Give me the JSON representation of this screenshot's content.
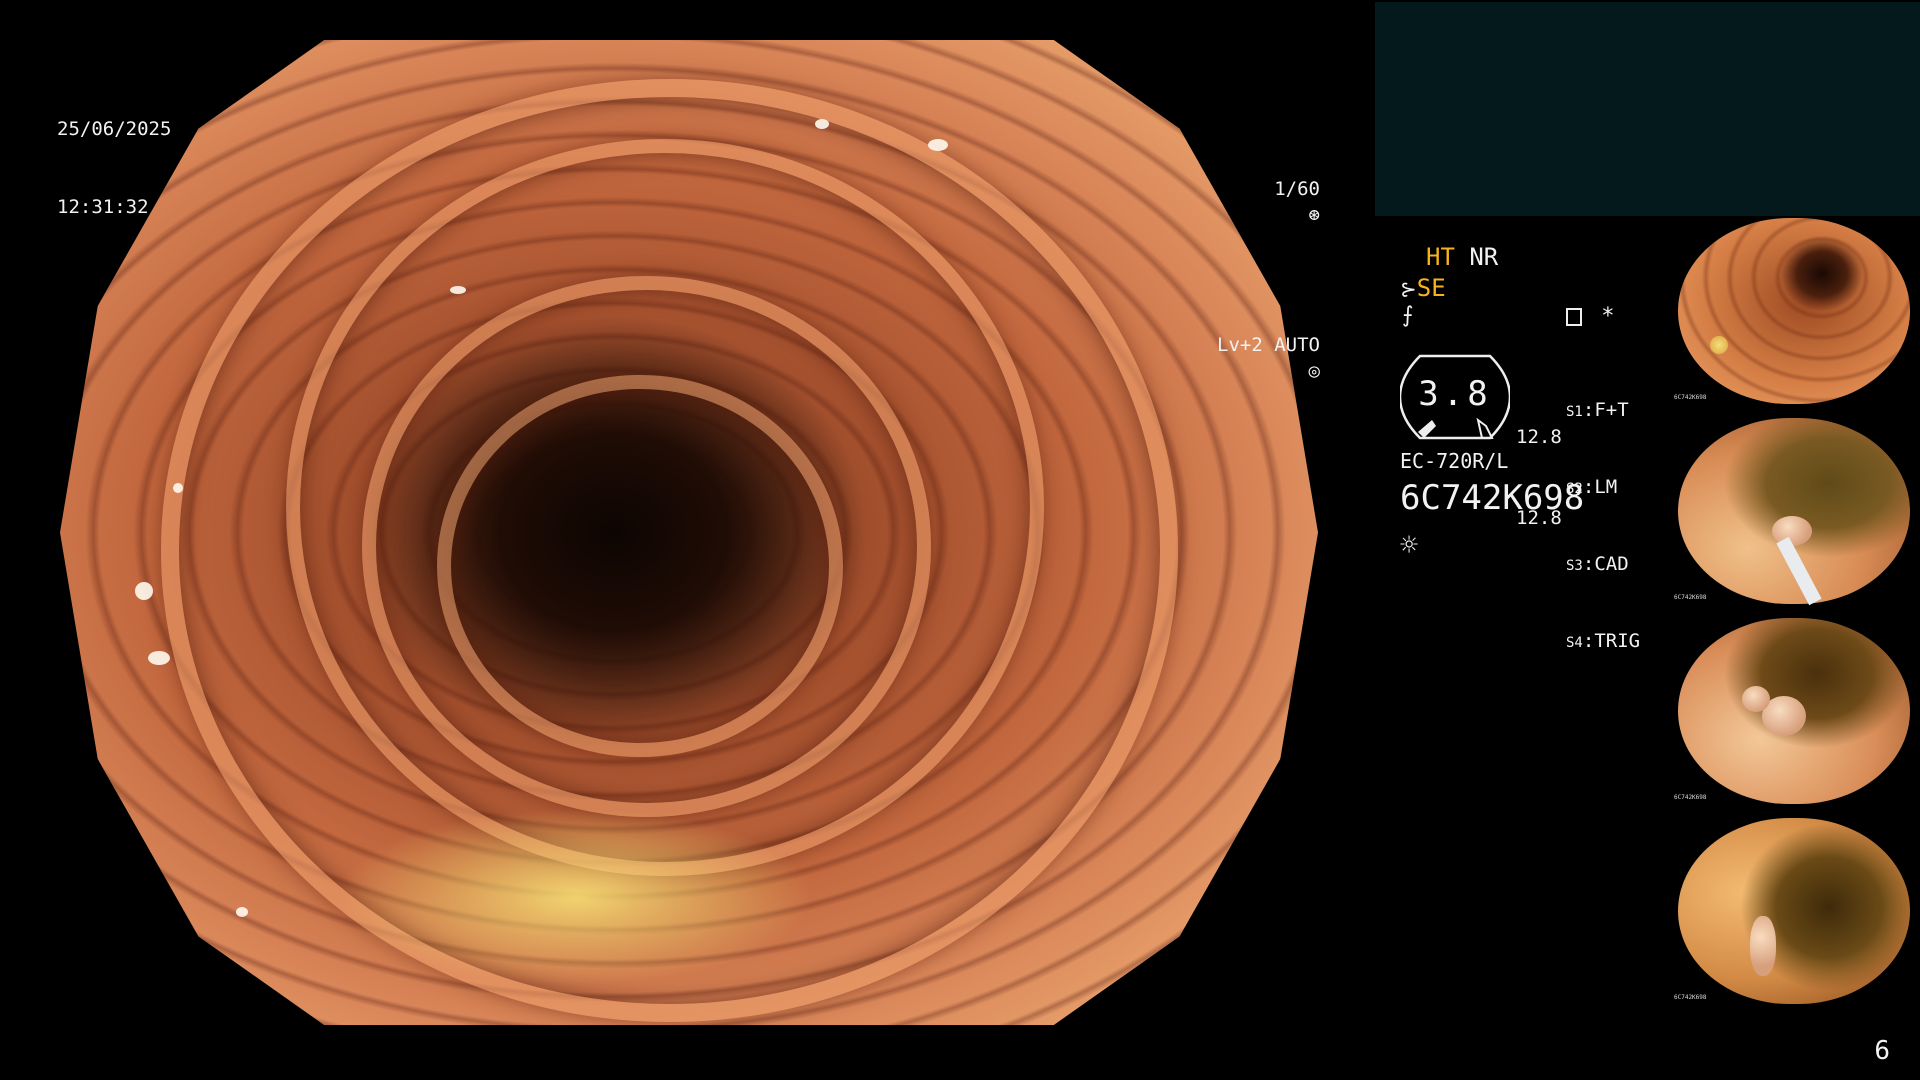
{
  "osd": {
    "date": "25/06/2025",
    "time": "12:31:32",
    "shutter": "1/60",
    "level": "Lv+2 AUTO"
  },
  "panel": {
    "ht": "HT",
    "nr": "NR",
    "se": "SE",
    "gauge_value": "3.8",
    "gauge_top": "12.8",
    "gauge_bottom": "12.8",
    "scope_model": "EC-720R/L",
    "serial": "6C742K698",
    "star": "*",
    "switches": [
      {
        "key": "S1",
        "value": "F+T"
      },
      {
        "key": "S2",
        "value": "LM"
      },
      {
        "key": "S3",
        "value": "CAD"
      },
      {
        "key": "S4",
        "value": "TRIG"
      }
    ]
  },
  "thumbnails": [
    {
      "name": "thumbnail-1",
      "serial": "6C742K698"
    },
    {
      "name": "thumbnail-2",
      "serial": "6C742K698"
    },
    {
      "name": "thumbnail-3",
      "serial": "6C742K698"
    },
    {
      "name": "thumbnail-4",
      "serial": "6C742K698"
    }
  ],
  "page_number": "6",
  "colors": {
    "background": "#000000",
    "accent_yellow": "#f7b21e",
    "panel_teal": "#03191c"
  },
  "icons": [
    "shutter-icon",
    "auto-exposure-icon",
    "structure-enhance-icon",
    "color-enhance-icon",
    "recording-icon",
    "light-source-icon"
  ]
}
